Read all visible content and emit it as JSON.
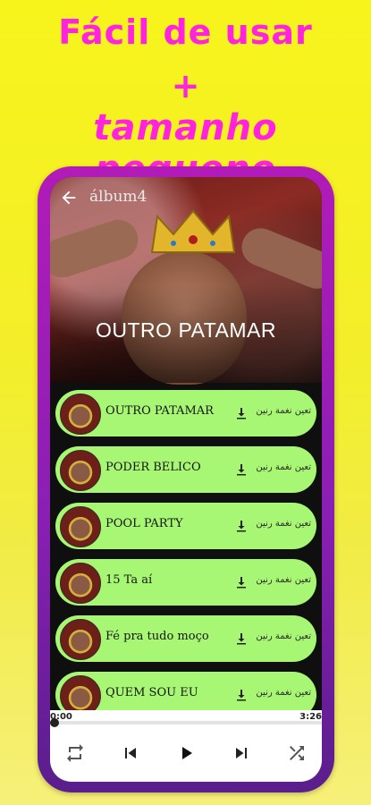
{
  "promo": {
    "line1": "Fácil de usar",
    "line2": "+",
    "line3": "tamanho pequeno"
  },
  "colors": {
    "promo_text": "#ff22e0",
    "phone_frame": "#b21bb8",
    "item_bg": "#a7f774"
  },
  "header": {
    "back_icon": "arrow-left-icon",
    "title": "álbum4"
  },
  "hero": {
    "title": "OUTRO PATAMAR"
  },
  "songs": [
    {
      "name": "OUTRO PATAMAR",
      "download_icon": "download-icon",
      "ringtone_label": "تعين نغمة رنين"
    },
    {
      "name": "PODER BÉLICO",
      "download_icon": "download-icon",
      "ringtone_label": "تعين نغمة رنين"
    },
    {
      "name": "POOL PARTY",
      "download_icon": "download-icon",
      "ringtone_label": "تعين نغمة رنين"
    },
    {
      "name": "15 Ta aí",
      "download_icon": "download-icon",
      "ringtone_label": "تعين نغمة رنين"
    },
    {
      "name": "Fé pra tudo moço",
      "download_icon": "download-icon",
      "ringtone_label": "تعين نغمة رنين"
    },
    {
      "name": "QUEM SOU EU",
      "download_icon": "download-icon",
      "ringtone_label": "تعين نغمة رنين"
    }
  ],
  "player": {
    "current_time": "0:00",
    "total_time": "3:26",
    "progress": 0.0,
    "controls": [
      "repeat-icon",
      "previous-icon",
      "play-icon",
      "next-icon",
      "shuffle-icon"
    ]
  }
}
